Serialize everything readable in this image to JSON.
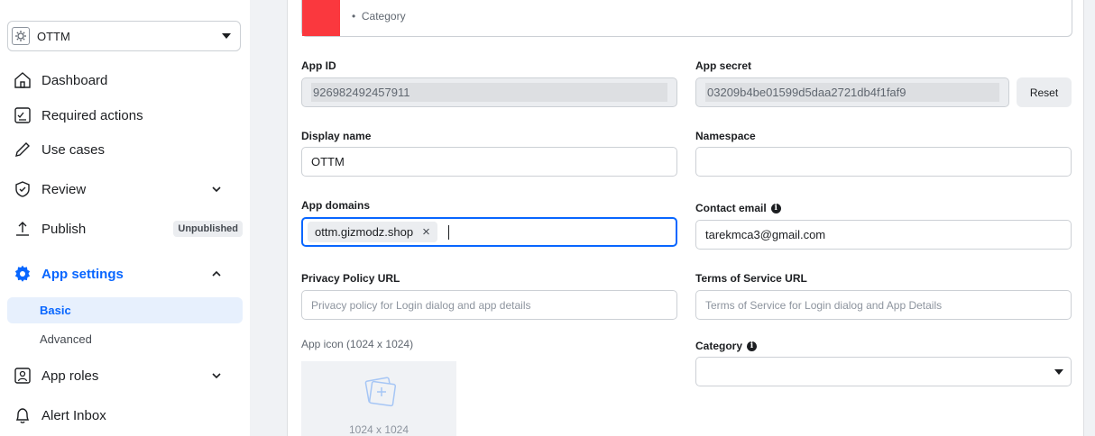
{
  "sidebar": {
    "app_selector": {
      "name": "OTTM"
    },
    "items": [
      {
        "label": "Dashboard"
      },
      {
        "label": "Required actions"
      },
      {
        "label": "Use cases"
      },
      {
        "label": "Review"
      },
      {
        "label": "Publish",
        "badge": "Unpublished"
      },
      {
        "label": "App settings"
      },
      {
        "label": "App roles"
      },
      {
        "label": "Alert Inbox"
      }
    ],
    "sub_items": [
      {
        "label": "Basic"
      },
      {
        "label": "Advanced"
      }
    ]
  },
  "main": {
    "category_bullet": "Category",
    "app_id": {
      "label": "App ID",
      "value": "926982492457911"
    },
    "app_secret": {
      "label": "App secret",
      "value": "03209b4be01599d5daa2721db4f1faf9",
      "reset_label": "Reset"
    },
    "display_name": {
      "label": "Display name",
      "value": "OTTM"
    },
    "namespace": {
      "label": "Namespace",
      "value": ""
    },
    "app_domains": {
      "label": "App domains",
      "chips": [
        "ottm.gizmodz.shop"
      ]
    },
    "contact_email": {
      "label": "Contact email",
      "value": "tarekmca3@gmail.com"
    },
    "privacy_policy": {
      "label": "Privacy Policy URL",
      "placeholder": "Privacy policy for Login dialog and app details"
    },
    "terms_of_service": {
      "label": "Terms of Service URL",
      "placeholder": "Terms of Service for Login dialog and App Details"
    },
    "app_icon": {
      "label": "App icon (1024 x 1024)",
      "size_text": "1024 x 1024"
    },
    "category": {
      "label": "Category",
      "value": ""
    }
  },
  "colors": {
    "accent": "#0866ff",
    "category_swatch": "#fa383e"
  }
}
